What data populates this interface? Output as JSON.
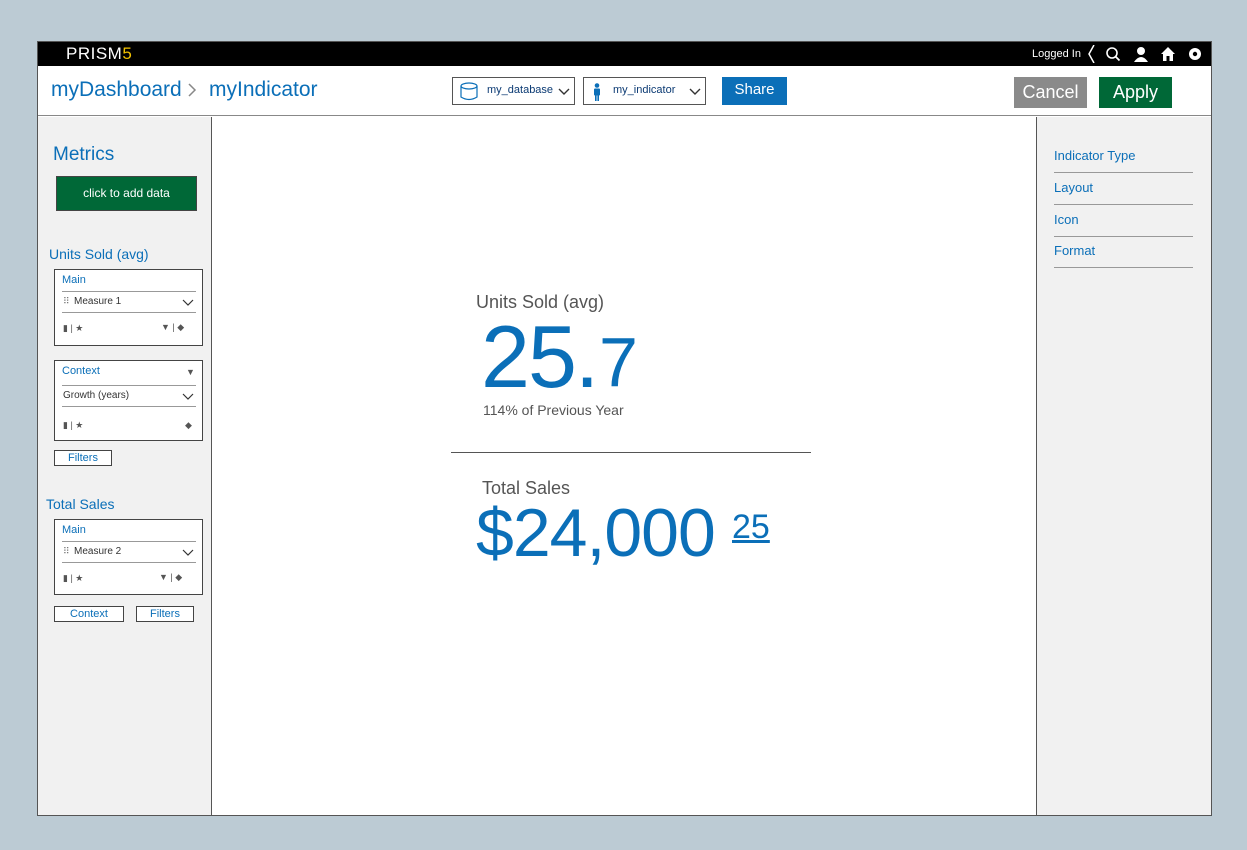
{
  "topbar": {
    "brand_text": "PRISM",
    "brand_version": "5",
    "logged_in": "Logged In",
    "icons": [
      "search-icon",
      "user-icon",
      "home-icon",
      "settings-icon"
    ]
  },
  "header": {
    "breadcrumb_root": "myDashboard",
    "breadcrumb_current": "myIndicator",
    "database_select": "my_database",
    "indicator_select": "my_indicator",
    "share_label": "Share",
    "cancel_label": "Cancel",
    "apply_label": "Apply"
  },
  "left": {
    "metrics_title": "Metrics",
    "add_data_label": "click to add data",
    "units_section": {
      "title": "Units Sold (avg)",
      "main_card": {
        "head": "Main",
        "measure": "Measure 1"
      },
      "context_card": {
        "head": "Context",
        "measure": "Growth (years)"
      },
      "filters_label": "Filters"
    },
    "sales_section": {
      "title": "Total Sales",
      "main_card": {
        "head": "Main",
        "measure": "Measure 2"
      },
      "context_label": "Context",
      "filters_label": "Filters"
    }
  },
  "right": {
    "items": [
      "Indicator Type",
      "Layout",
      "Icon",
      "Format"
    ]
  },
  "main": {
    "metric1": {
      "label": "Units Sold (avg)",
      "value_int": "25.",
      "value_dec": "7",
      "comparison": "114% of Previous Year"
    },
    "metric2": {
      "label": "Total Sales",
      "value_main": "$24,000",
      "value_cents": "25"
    }
  },
  "colors": {
    "accent_blue": "#0b6fb8",
    "apply_green": "#006837",
    "cancel_gray": "#8a8a8a",
    "background": "#bccbd4"
  }
}
